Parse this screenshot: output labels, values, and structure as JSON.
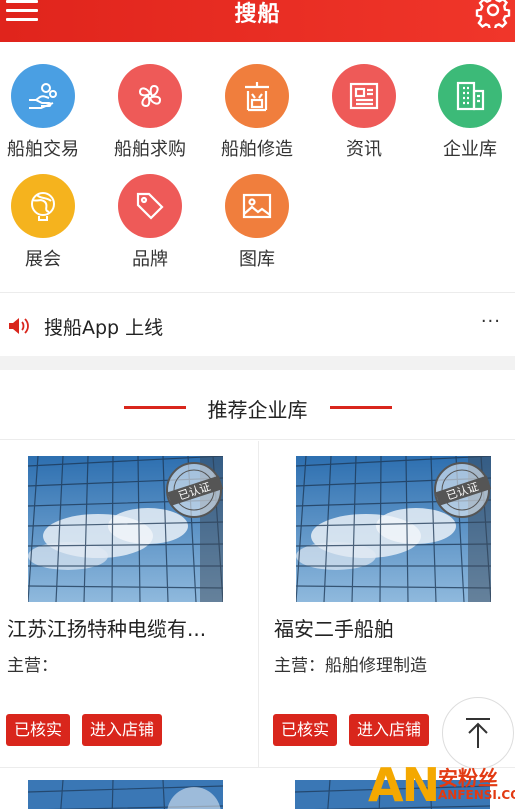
{
  "header": {
    "title": "搜船"
  },
  "categories": [
    {
      "label": "船舶交易",
      "color": "#4a9fe3",
      "icon": "hand-coins-icon"
    },
    {
      "label": "船舶求购",
      "color": "#ee5a58",
      "icon": "clover-icon"
    },
    {
      "label": "船舶修造",
      "color": "#f07e3d",
      "icon": "shop-icon"
    },
    {
      "label": "资讯",
      "color": "#ee5a58",
      "icon": "newspaper-icon"
    },
    {
      "label": "企业库",
      "color": "#3cba78",
      "icon": "building-icon"
    },
    {
      "label": "展会",
      "color": "#f5b31e",
      "icon": "globe-icon"
    },
    {
      "label": "品牌",
      "color": "#ee5a58",
      "icon": "tag-icon"
    },
    {
      "label": "图库",
      "color": "#f07e3d",
      "icon": "image-icon"
    }
  ],
  "notice": {
    "text": "搜船App 上线",
    "more": "···"
  },
  "section": {
    "title": "推荐企业库"
  },
  "companies": [
    {
      "name": "江苏江扬特种电缆有...",
      "business": "主营：",
      "verified": "已核实",
      "enter": "进入店铺",
      "badge": "已认证"
    },
    {
      "name": "福安二手船舶",
      "business": "主营：船舶修理制造",
      "verified": "已核实",
      "enter": "进入店铺",
      "badge": "已认证"
    }
  ],
  "watermark": {
    "brand": "AN",
    "cn": "安粉丝",
    "en": "ANFENSI.COM"
  },
  "colors": {
    "primary": "#d9261c",
    "header": "#e8301f"
  }
}
